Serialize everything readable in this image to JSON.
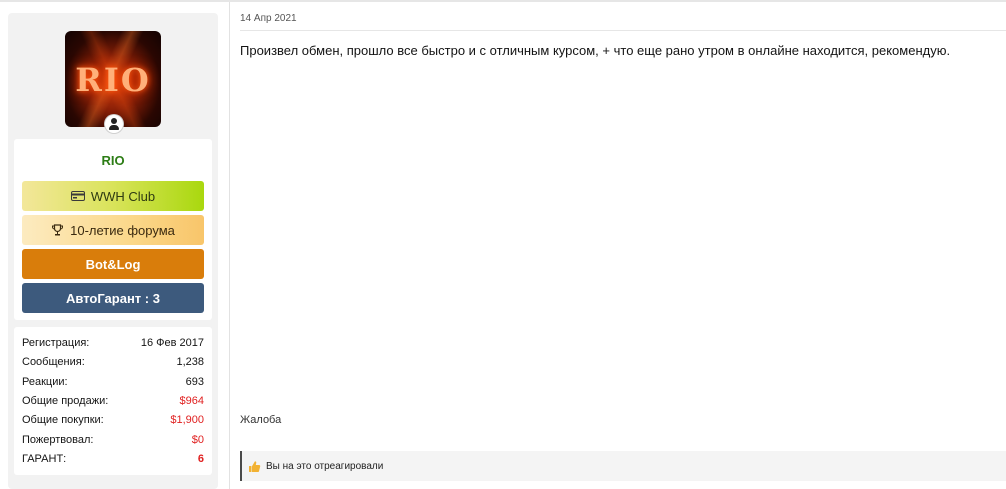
{
  "user": {
    "name": "RIO",
    "avatar_text": "RIO",
    "banners": [
      {
        "label": "WWH Club",
        "icon": "card-icon"
      },
      {
        "label": "10-летие форума",
        "icon": "trophy-icon"
      },
      {
        "label": "Bot&Log"
      },
      {
        "label": "АвтоГарант : 3"
      }
    ],
    "stats": [
      {
        "label": "Регистрация:",
        "value": "16 Фев 2017"
      },
      {
        "label": "Сообщения:",
        "value": "1,238"
      },
      {
        "label": "Реакции:",
        "value": "693"
      },
      {
        "label": "Общие продажи:",
        "value": "$964"
      },
      {
        "label": "Общие покупки:",
        "value": "$1,900"
      },
      {
        "label": "Пожертвовал:",
        "value": "$0"
      },
      {
        "label": "ГАРАНТ:",
        "value": "6"
      }
    ]
  },
  "post": {
    "date": "14 Апр 2021",
    "text": "Произвел обмен, прошло все быстро и с отличным курсом, + что еще рано утром в онлайне находится, рекомендую.",
    "report_label": "Жалоба",
    "reactions_text": "Вы на это отреагировали"
  },
  "colors": {
    "username": "#2d7d16",
    "botlog": "#d97d0b",
    "autogarant": "#3d5a7d",
    "money": "#e02020"
  }
}
